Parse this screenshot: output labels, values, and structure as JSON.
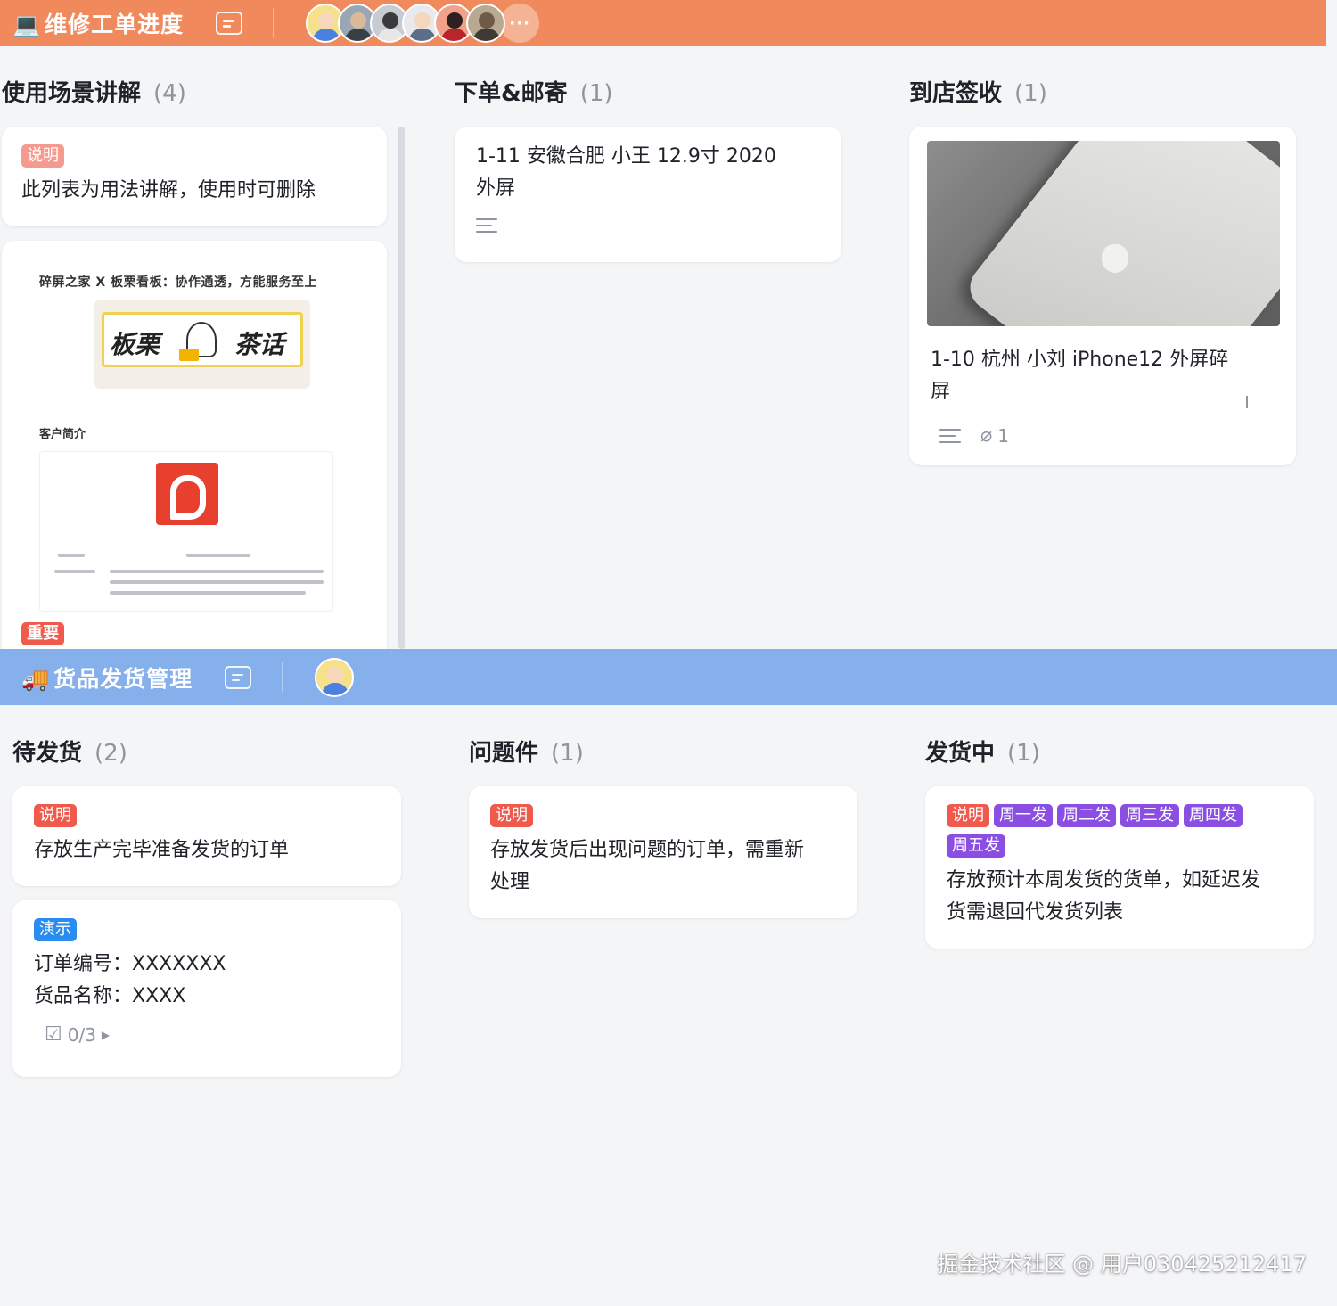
{
  "board1": {
    "emoji": "💻",
    "title": "维修工单进度",
    "more": "···",
    "columns": [
      {
        "title": "使用场景讲解",
        "count": "(4)"
      },
      {
        "title": "下单&邮寄",
        "count": "(1)"
      },
      {
        "title": "到店签收",
        "count": "(1)"
      }
    ],
    "col1_card1": {
      "tag": "说明",
      "text": "此列表为用法讲解，使用时可删除"
    },
    "col1_card2": {
      "headline": "碎屏之家 X 板栗看板：协作通透，方能服务至上",
      "banner_left": "板栗",
      "banner_right": "茶话",
      "section": "客户简介",
      "tag": "重要"
    },
    "col2_card1": {
      "line1": "1-11 安徽合肥  小王  12.9寸  2020",
      "line2": "外屏"
    },
    "col3_card1": {
      "line1": "1-10  杭州  小刘  iPhone12  外屏碎",
      "line2": "屏",
      "attach_count": "1"
    }
  },
  "board2": {
    "emoji": "🚚",
    "title": "货品发货管理",
    "columns": [
      {
        "title": "待发货",
        "count": "(2)"
      },
      {
        "title": "问题件",
        "count": "(1)"
      },
      {
        "title": "发货中",
        "count": "(1)"
      }
    ],
    "col1_card1": {
      "tag": "说明",
      "text": "存放生产完毕准备发货的订单"
    },
    "col1_card2": {
      "tag": "演示",
      "line1": "订单编号：XXXXXXX",
      "line2": "货品名称：XXXX",
      "checklist": "0/3"
    },
    "col2_card1": {
      "tag": "说明",
      "line1": "存放发货后出现问题的订单，需重新",
      "line2": "处理"
    },
    "col3_card1": {
      "tags": [
        "说明",
        "周一发",
        "周二发",
        "周三发",
        "周四发",
        "周五发"
      ],
      "line1": "存放预计本周发货的货单，如延迟发",
      "line2": "货需退回代发货列表"
    }
  },
  "watermark": "掘金技术社区 @ 用户030425212417",
  "colors": {
    "board1_bar": "#f08a5d",
    "board2_bar": "#86b0ec",
    "tag_red": "#ef5a4d",
    "tag_blue": "#2a8cf0",
    "tag_purple": "#8b4ee3"
  }
}
